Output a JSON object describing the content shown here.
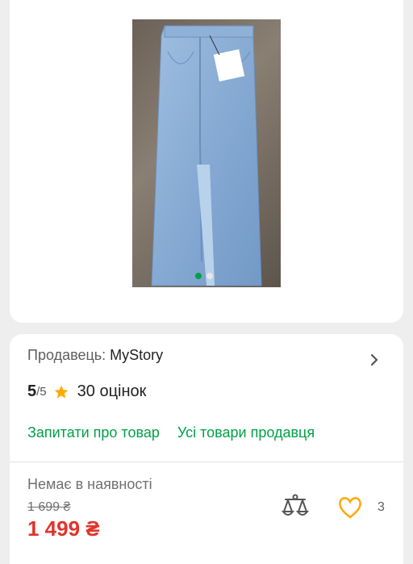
{
  "gallery": {
    "image_alt": "Denim skirt",
    "dot_count": 2,
    "active_dot": 0
  },
  "seller": {
    "label": "Продавець: ",
    "name": "MyStory",
    "rating_value": "5",
    "rating_max": "/5",
    "reviews": "30 оцінок"
  },
  "links": {
    "ask": "Запитати про товар",
    "all_items": "Усі товари продавця"
  },
  "product": {
    "stock_status": "Немає в наявності",
    "old_price": "1 699 ₴",
    "new_price": "1 499 ₴",
    "favorites_count": "3"
  },
  "colors": {
    "accent_green": "#00a046",
    "price_red": "#e0352d",
    "star_orange": "#ffa900"
  }
}
